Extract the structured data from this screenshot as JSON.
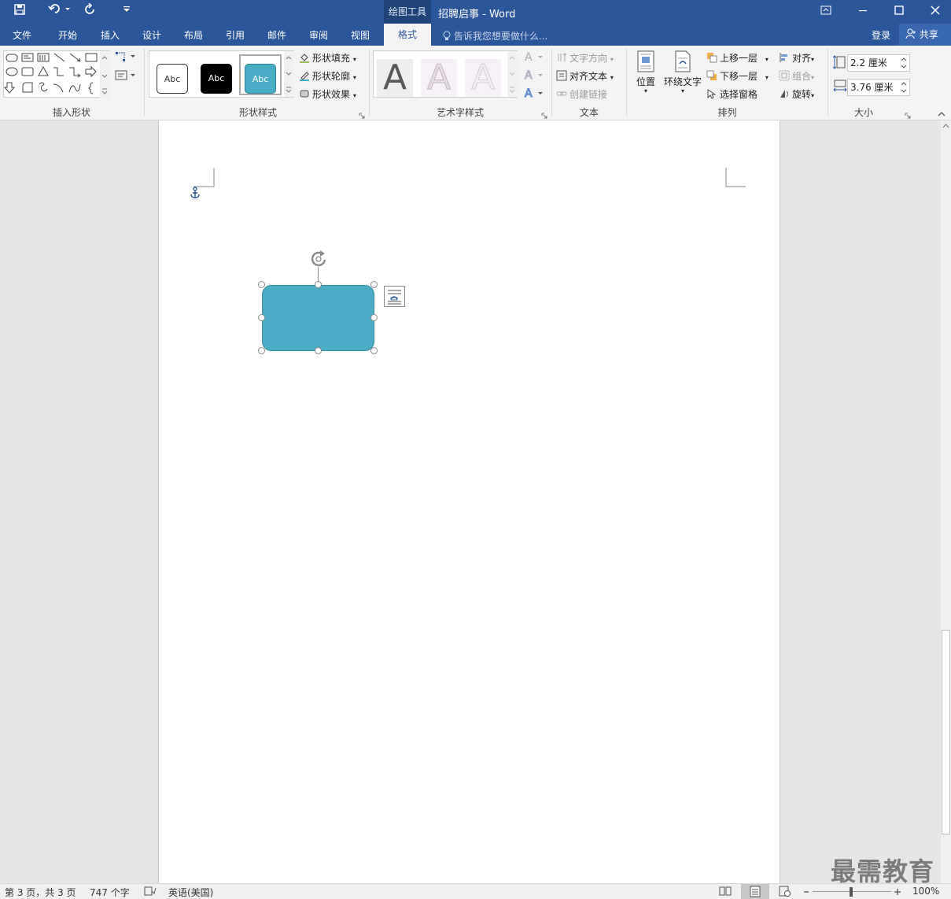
{
  "window": {
    "context_label": "绘图工具",
    "title": "招聘启事 - Word"
  },
  "tabs": [
    "文件",
    "开始",
    "插入",
    "设计",
    "布局",
    "引用",
    "邮件",
    "审阅",
    "视图",
    "格式"
  ],
  "tell_me": "告诉我您想要做什么...",
  "account": {
    "signin": "登录",
    "share": "共享"
  },
  "ribbon": {
    "groups": {
      "insert_shapes": "插入形状",
      "shape_styles": "形状样式",
      "wordart_styles": "艺术字样式",
      "text": "文本",
      "arrange": "排列",
      "size": "大小"
    },
    "style_samples": [
      "Abc",
      "Abc",
      "Abc"
    ],
    "wordart_samples": [
      "A",
      "A",
      "A"
    ],
    "shape_fill": "形状填充",
    "shape_outline": "形状轮廓",
    "shape_effects": "形状效果",
    "text_direction": "文字方向",
    "align_text": "对齐文本",
    "create_link": "创建链接",
    "position": "位置",
    "wrap_text": "环绕文字",
    "bring_forward": "上移一层",
    "send_backward": "下移一层",
    "selection_pane": "选择窗格",
    "align": "对齐",
    "group": "组合",
    "rotate": "旋转",
    "height": "2.2 厘米",
    "width": "3.76 厘米"
  },
  "colors": {
    "brand": "#2b579a",
    "shape_fill": "#4bacc6"
  },
  "status": {
    "page": "第 3 页，共 3 页",
    "words": "747 个字",
    "language": "英语(美国)",
    "zoom": "100%"
  },
  "watermark": "最需教育"
}
